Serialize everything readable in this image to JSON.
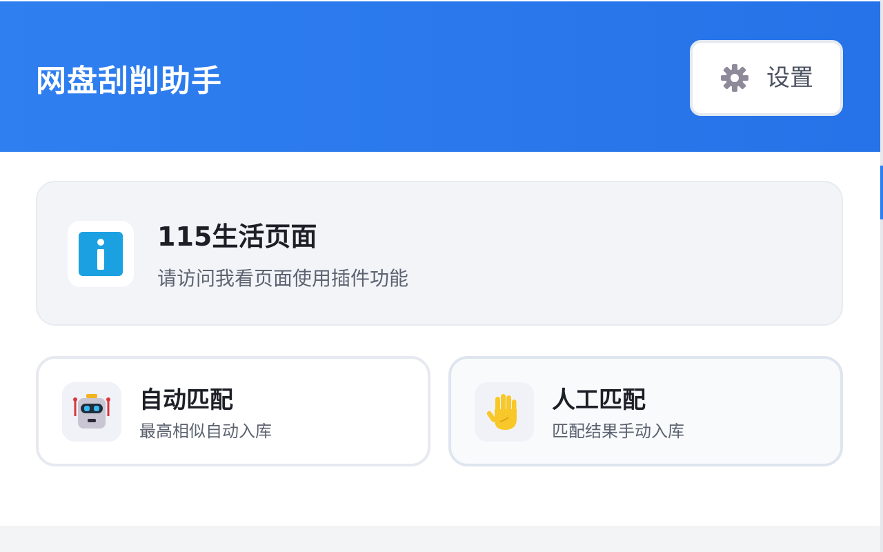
{
  "header": {
    "title": "网盘刮削助手",
    "settings_label": "设置",
    "settings_icon": "gear-icon",
    "bg_color": "#2a78ec"
  },
  "info": {
    "icon": "info-icon",
    "title": "115生活页面",
    "subtitle": "请访问我看页面使用插件功能"
  },
  "modes": [
    {
      "icon": "robot-icon",
      "title": "自动匹配",
      "subtitle": "最高相似自动入库"
    },
    {
      "icon": "raised-hand-icon",
      "title": "人工匹配",
      "subtitle": "匹配结果手动入库"
    }
  ]
}
